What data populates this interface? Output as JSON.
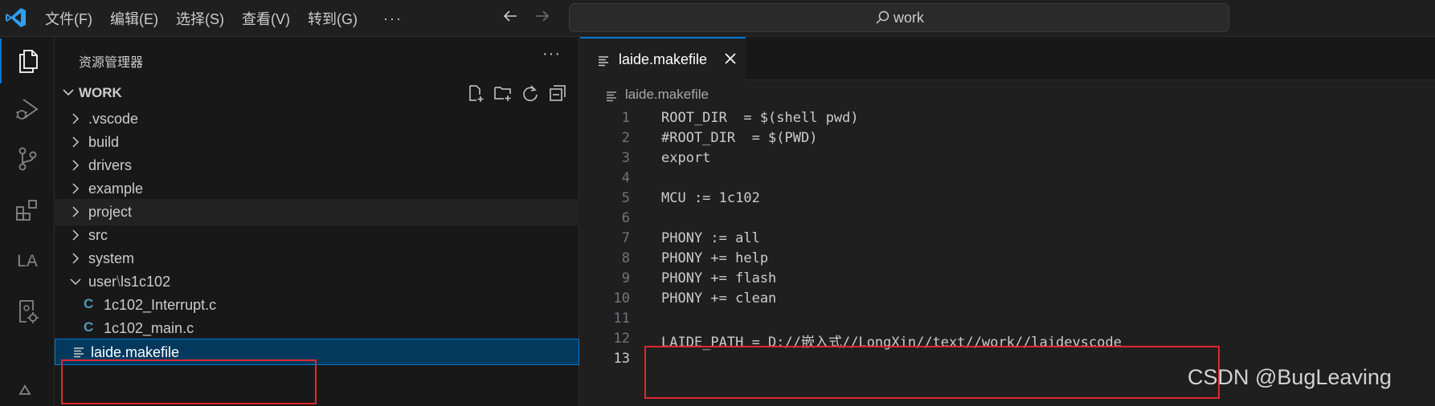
{
  "titlebar": {
    "menu": [
      "文件(F)",
      "编辑(E)",
      "选择(S)",
      "查看(V)",
      "转到(G)"
    ],
    "more": "···",
    "search_text": "work"
  },
  "activity_bar": {
    "items": [
      "explorer-icon",
      "run-debug-icon",
      "source-control-icon",
      "extensions-icon",
      "LA",
      "remote-debug-icon"
    ],
    "la_label": "LA"
  },
  "sidebar": {
    "title": "资源管理器",
    "more": "···",
    "workspace": "WORK",
    "tree": [
      {
        "label": ".vscode",
        "type": "folder"
      },
      {
        "label": "build",
        "type": "folder"
      },
      {
        "label": "drivers",
        "type": "folder"
      },
      {
        "label": "example",
        "type": "folder"
      },
      {
        "label": "project",
        "type": "folder"
      },
      {
        "label": "src",
        "type": "folder"
      },
      {
        "label": "system",
        "type": "folder"
      },
      {
        "label": "user",
        "label2": "ls1c102",
        "sep": "\\",
        "type": "folder-open"
      },
      {
        "label": "1c102_Interrupt.c",
        "type": "c",
        "icon_text": "C"
      },
      {
        "label": "1c102_main.c",
        "type": "c",
        "icon_text": "C"
      },
      {
        "label": "laide.makefile",
        "type": "makefile"
      }
    ]
  },
  "editor": {
    "tab_label": "laide.makefile",
    "breadcrumb": "laide.makefile",
    "lines": [
      {
        "n": "1",
        "text": "ROOT_DIR  = $(shell pwd)"
      },
      {
        "n": "2",
        "text": "#ROOT_DIR  = $(PWD)"
      },
      {
        "n": "3",
        "text": "export"
      },
      {
        "n": "4",
        "text": ""
      },
      {
        "n": "5",
        "text": "MCU := 1c102"
      },
      {
        "n": "6",
        "text": ""
      },
      {
        "n": "7",
        "text": "PHONY := all"
      },
      {
        "n": "8",
        "text": "PHONY += help"
      },
      {
        "n": "9",
        "text": "PHONY += flash"
      },
      {
        "n": "10",
        "text": "PHONY += clean"
      },
      {
        "n": "11",
        "text": ""
      },
      {
        "n": "12",
        "text": "LAIDE_PATH = D://嵌入式//LongXin//text//work//laidevscode"
      },
      {
        "n": "13",
        "text": ""
      }
    ]
  },
  "watermark": "CSDN @BugLeaving",
  "colors": {
    "accent": "#0078d4",
    "annotation": "#e0282e",
    "c_icon": "#519aba"
  }
}
